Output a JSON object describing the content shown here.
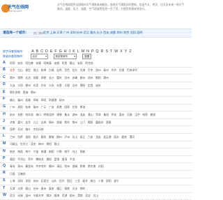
{
  "header": {
    "logo_text": "天气在线网",
    "logo_sub": "tianqi.com",
    "intro": "天气在线网提供全国城市天气预报查询服务，各地天气预报实时更新，包括今天、明天、后天及未来一周天气情况，温度、风力、湿度、空气质量等信息一目了然，方便您合理安排出行。"
  },
  "choose": {
    "title": "请选择一个城市：",
    "label": "热门城市",
    "hot_cities": [
      "北京",
      "上海",
      "天津",
      "广州",
      "深圳",
      "杭州",
      "武汉",
      "重庆",
      "长沙",
      "西安",
      "成都",
      "郑州",
      "南京",
      "沈阳",
      "昆明"
    ]
  },
  "letters": {
    "label": "按字母查找城市：",
    "items": [
      "A",
      "B",
      "C",
      "D",
      "E",
      "F",
      "G",
      "H",
      "J",
      "K",
      "L",
      "M",
      "N",
      "P",
      "Q",
      "R",
      "S",
      "T",
      "W",
      "X",
      "Y",
      "Z"
    ]
  },
  "province": {
    "label": "按省份查找城市：",
    "select1": "北京",
    "select2": "请选择城市",
    "button": "查看"
  },
  "rows": [
    {
      "letter": "A",
      "cities": [
        "阿坝",
        "安庆",
        "阿拉善",
        "安康",
        "阿勒泰",
        "安顺",
        "阿里",
        "鞍山",
        "安阳",
        "阿克苏"
      ]
    },
    {
      "letter": "B",
      "cities": [
        "北京",
        "白山",
        "保定",
        "保山",
        "蚌埠",
        "白城",
        "宝鸡",
        "百色",
        "包头",
        "北海",
        "巴中",
        "滨州",
        "亳州",
        "毕节",
        "白银",
        "巴彦淖尔"
      ]
    },
    {
      "letter": "C",
      "cities": [
        "常州",
        "常德",
        "长治",
        "成都",
        "承德",
        "长沙",
        "重庆",
        "沧州",
        "赤峰",
        "郴州",
        "池州",
        "朝阳",
        "潮州"
      ]
    },
    {
      "letter": "D",
      "cities": [
        "大连",
        "大同",
        "德州",
        "东莞",
        "丹东",
        "大庆",
        "东营",
        "大理",
        "达州",
        "德阳",
        "定西",
        "迪庆"
      ]
    },
    {
      "letter": "E",
      "cities": [
        "鄂尔多斯",
        "恩施",
        "鄂州"
      ]
    },
    {
      "letter": "F",
      "cities": [
        "佛山",
        "福州",
        "抚顺",
        "阜新",
        "阜阳",
        "防城港",
        "抚州"
      ]
    },
    {
      "letter": "G",
      "cities": [
        "广州",
        "贵阳",
        "桂林",
        "赣州",
        "广元",
        "广安",
        "贵港",
        "固原",
        "甘孜",
        "果洛"
      ]
    },
    {
      "letter": "H",
      "cities": [
        "杭州",
        "合肥",
        "哈尔滨",
        "海口",
        "呼和浩特",
        "邯郸",
        "衡水",
        "湖州",
        "淮安",
        "黄山",
        "菏泽",
        "衡阳",
        "怀化",
        "惠州",
        "河源",
        "汉中",
        "哈密",
        "鹤岗"
      ]
    },
    {
      "letter": "J",
      "cities": [
        "济南",
        "嘉兴",
        "金华",
        "九江",
        "吉林",
        "锦州",
        "晋城",
        "焦作",
        "荆州",
        "江门",
        "揭阳",
        "嘉峪关",
        "酒泉"
      ]
    },
    {
      "letter": "K",
      "cities": [
        "昆明",
        "开封",
        "喀什",
        "克拉玛依"
      ]
    },
    {
      "letter": "L",
      "cities": [
        "兰州",
        "拉萨",
        "洛阳",
        "临沂",
        "廊坊",
        "聊城",
        "柳州",
        "泸州",
        "乐山",
        "丽江",
        "六安",
        "龙岩",
        "连云港",
        "丽水",
        "娄底",
        "漯河"
      ]
    },
    {
      "letter": "M",
      "cities": [
        "马鞍山",
        "牡丹江",
        "茂名",
        "梅州",
        "绵阳",
        "眉山"
      ]
    },
    {
      "letter": "N",
      "cities": [
        "南京",
        "南昌",
        "南宁",
        "宁波",
        "南通",
        "南阳",
        "宁德",
        "南平",
        "内江",
        "那曲"
      ]
    },
    {
      "letter": "P",
      "cities": [
        "莆田",
        "平顶山",
        "萍乡",
        "攀枝花",
        "濮阳",
        "盘锦",
        "普洱",
        "平凉"
      ]
    },
    {
      "letter": "Q",
      "cities": [
        "青岛",
        "泉州",
        "秦皇岛",
        "齐齐哈尔",
        "衢州",
        "清远",
        "钦州",
        "曲靖",
        "黔南",
        "黔东南",
        "庆阳"
      ]
    },
    {
      "letter": "R",
      "cities": [
        "日照",
        "日喀则"
      ]
    },
    {
      "letter": "S",
      "cities": [
        "上海",
        "深圳",
        "沈阳",
        "苏州",
        "石家庄",
        "汕头",
        "绍兴",
        "宿迁",
        "三亚",
        "韶关",
        "商丘",
        "十堰",
        "邵阳",
        "遂宁"
      ]
    },
    {
      "letter": "T",
      "cities": [
        "天津",
        "太原",
        "唐山",
        "台州",
        "泰州",
        "泰安",
        "通辽",
        "铜陵",
        "天水",
        "铁岭"
      ]
    },
    {
      "letter": "W",
      "cities": [
        "武汉",
        "无锡",
        "温州",
        "乌鲁木齐",
        "潍坊",
        "威海",
        "芜湖",
        "梧州",
        "渭南",
        "吴忠",
        "文山"
      ]
    }
  ]
}
